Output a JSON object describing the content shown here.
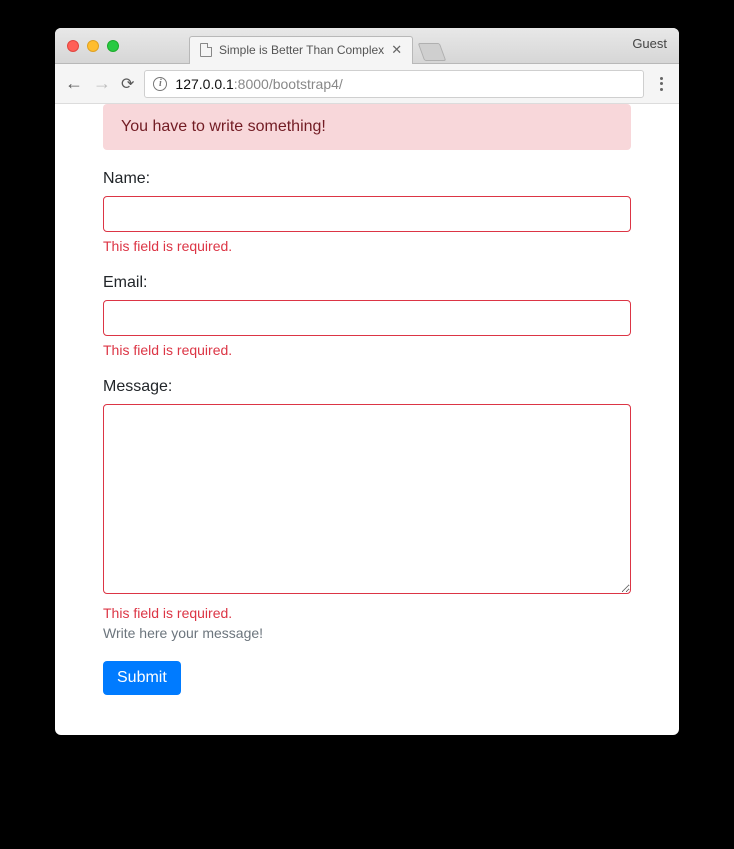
{
  "browser": {
    "tab_title": "Simple is Better Than Complex",
    "guest_label": "Guest",
    "url_host": "127.0.0.1",
    "url_port": ":8000",
    "url_path": "/bootstrap4/"
  },
  "alert": {
    "message": "You have to write something!"
  },
  "form": {
    "name": {
      "label": "Name:",
      "value": "",
      "error": "This field is required."
    },
    "email": {
      "label": "Email:",
      "value": "",
      "error": "This field is required."
    },
    "message": {
      "label": "Message:",
      "value": "",
      "error": "This field is required.",
      "help": "Write here your message!"
    },
    "submit_label": "Submit"
  }
}
